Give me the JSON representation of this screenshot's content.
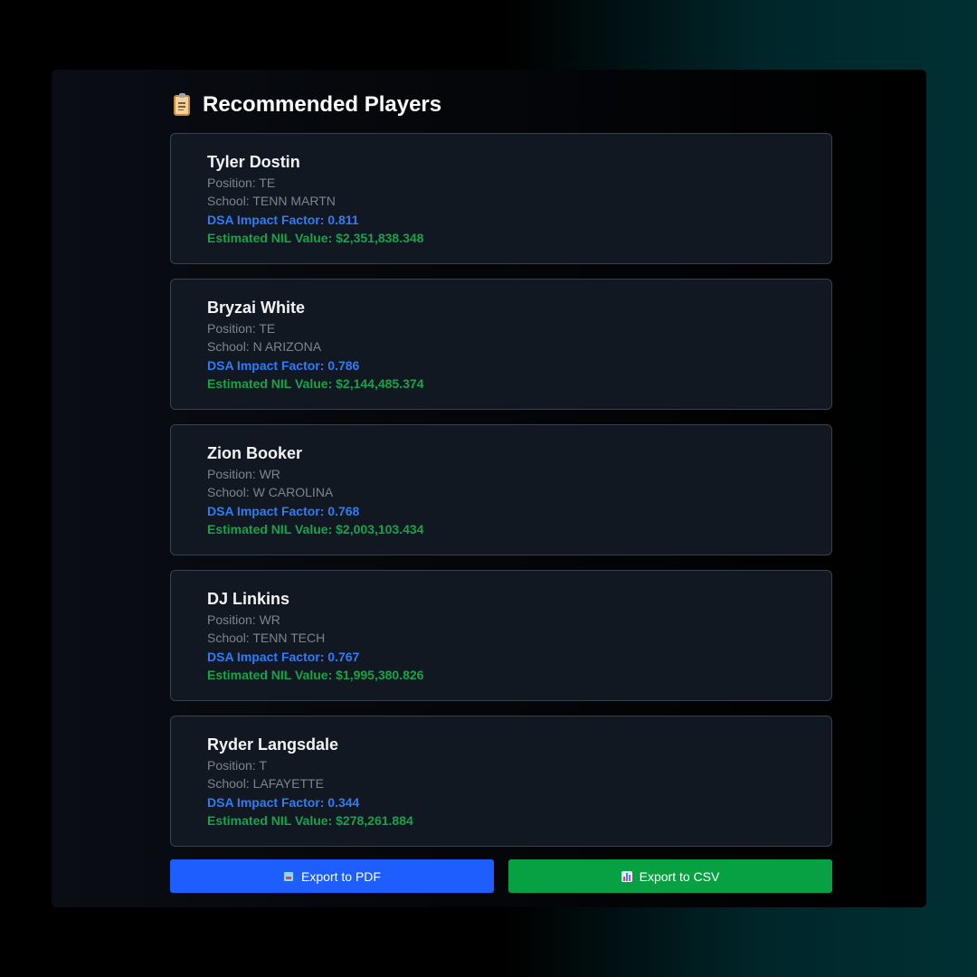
{
  "section": {
    "title": "Recommended Players",
    "title_icon": "clipboard-icon"
  },
  "players": [
    {
      "name": "Tyler Dostin",
      "position": "Position: TE",
      "school": "School: TENN MARTN",
      "impact": "DSA Impact Factor: 0.811",
      "nil": "Estimated NIL Value: $2,351,838.348"
    },
    {
      "name": "Bryzai White",
      "position": "Position: TE",
      "school": "School: N ARIZONA",
      "impact": "DSA Impact Factor: 0.786",
      "nil": "Estimated NIL Value: $2,144,485.374"
    },
    {
      "name": "Zion Booker",
      "position": "Position: WR",
      "school": "School: W CAROLINA",
      "impact": "DSA Impact Factor: 0.768",
      "nil": "Estimated NIL Value: $2,003,103.434"
    },
    {
      "name": "DJ Linkins",
      "position": "Position: WR",
      "school": "School: TENN TECH",
      "impact": "DSA Impact Factor: 0.767",
      "nil": "Estimated NIL Value: $1,995,380.826"
    },
    {
      "name": "Ryder Langsdale",
      "position": "Position: T",
      "school": "School: LAFAYETTE",
      "impact": "DSA Impact Factor: 0.344",
      "nil": "Estimated NIL Value: $278,261.884"
    }
  ],
  "actions": {
    "pdf_label": "Export to PDF",
    "pdf_icon": "inbox-icon",
    "csv_label": "Export to CSV",
    "csv_icon": "bar-chart-icon"
  },
  "colors": {
    "impact": "#2f7df6",
    "nil": "#16a34a",
    "pdf_button": "#1e5eff",
    "csv_button": "#07a143"
  }
}
